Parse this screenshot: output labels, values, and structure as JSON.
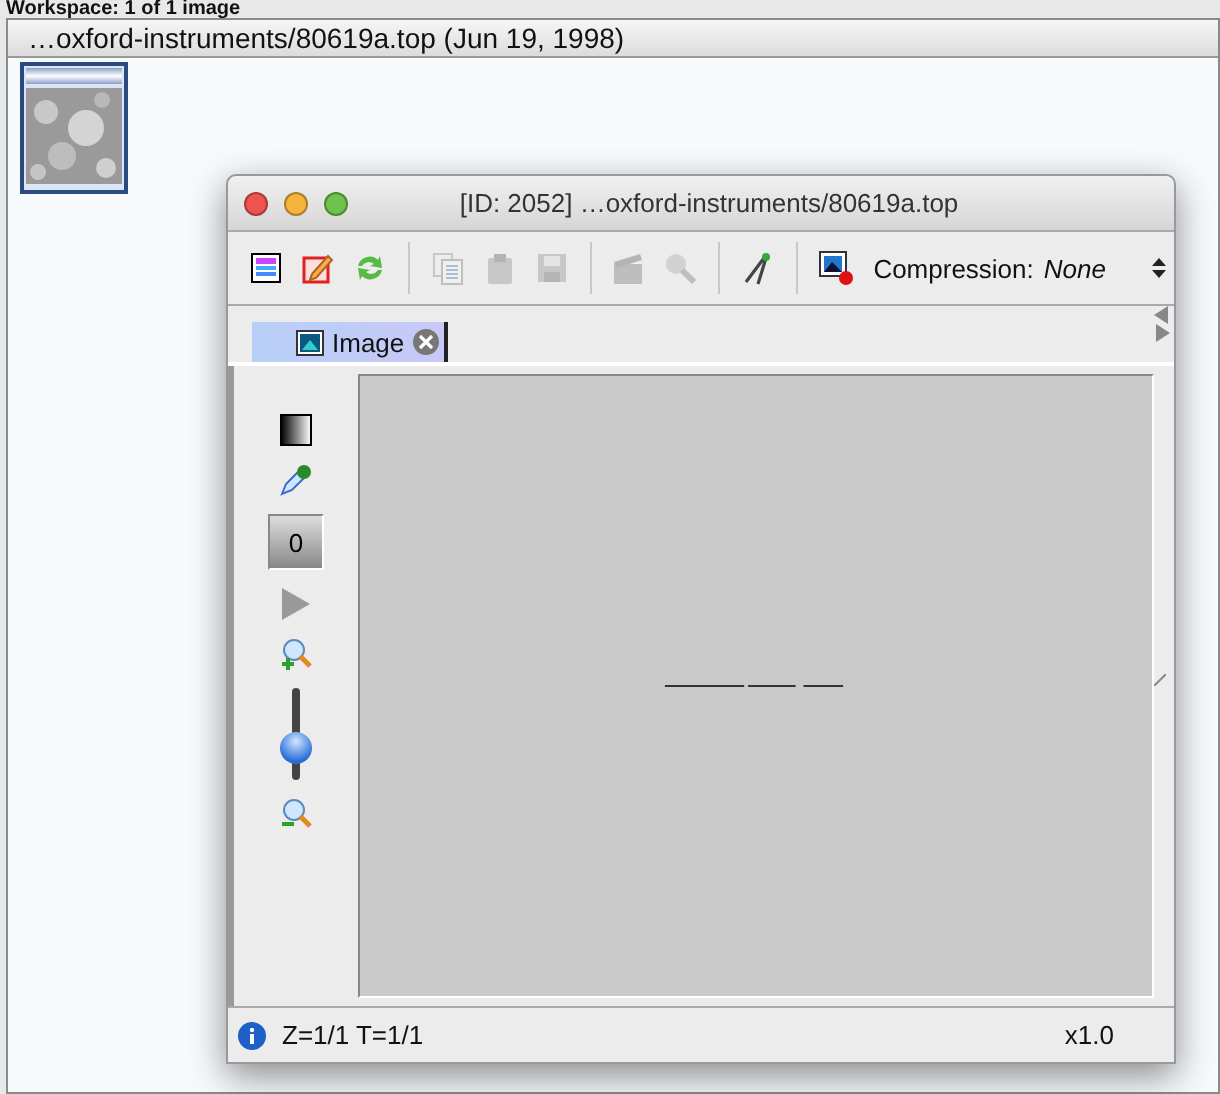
{
  "workspace": {
    "header": "Workspace: 1 of 1 image",
    "title": "…oxford-instruments/80619a.top (Jun 19, 1998)",
    "thumbnails": [
      {
        "kind": "picture",
        "selected": true
      }
    ]
  },
  "window": {
    "title": "[ID: 2052] …oxford-instruments/80619a.top",
    "toolbar": [
      [
        {
          "disabled": false
        },
        {
          "disabled": false
        },
        {
          "disabled": false
        }
      ],
      [
        {
          "disabled": true
        },
        {
          "disabled": true
        },
        {
          "disabled": true
        }
      ],
      [
        {
          "disabled": true
        },
        {
          "disabled": true
        }
      ],
      [
        {
          "disabled": false
        }
      ],
      [
        {
          "disabled": false
        }
      ]
    ],
    "compression": {
      "label": "Compression:",
      "value": "None"
    },
    "tabs": [
      {
        "label": "Image",
        "selected": true
      }
    ],
    "tools": {
      "channel_button": "0",
      "zoom": {
        "level": 0.35
      }
    },
    "status_bar": {
      "position": "Z=1/1 T=1/1",
      "zoom": "x1.0"
    }
  }
}
